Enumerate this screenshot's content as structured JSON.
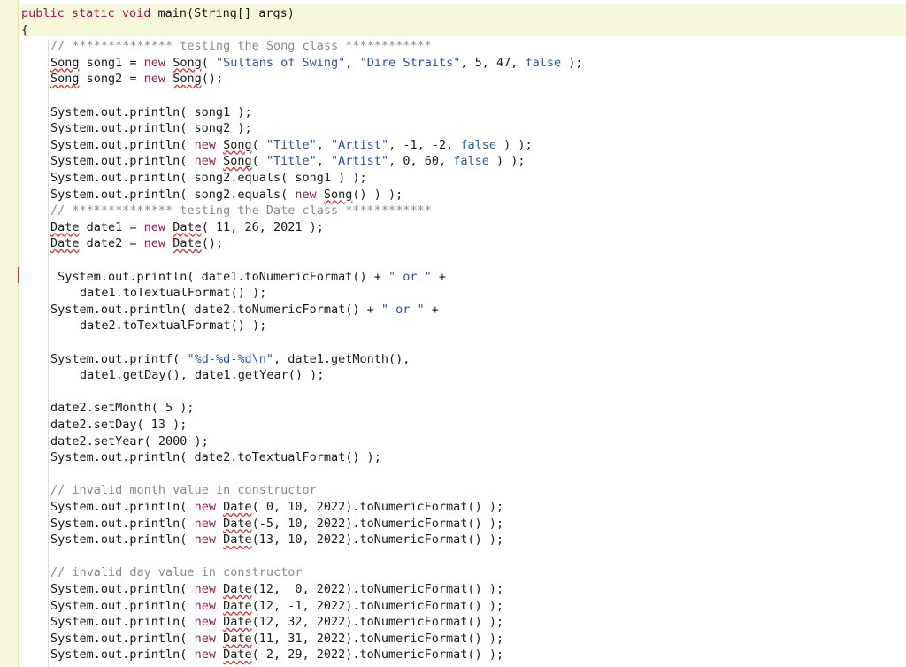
{
  "editor": {
    "language": "java",
    "lines": [
      {
        "indent": 0,
        "tokens": [
          {
            "t": "kw",
            "v": "public"
          },
          {
            "t": "p",
            "v": " "
          },
          {
            "t": "kw",
            "v": "static"
          },
          {
            "t": "p",
            "v": " "
          },
          {
            "t": "kw",
            "v": "void"
          },
          {
            "t": "p",
            "v": " main(String[] args)"
          }
        ]
      },
      {
        "indent": 0,
        "tokens": [
          {
            "t": "p",
            "v": "{"
          }
        ]
      },
      {
        "indent": 1,
        "tokens": [
          {
            "t": "cm",
            "v": "// ************** testing the Song class ************"
          }
        ]
      },
      {
        "indent": 1,
        "tokens": [
          {
            "t": "err",
            "v": "Song"
          },
          {
            "t": "p",
            "v": " song1 = "
          },
          {
            "t": "kw",
            "v": "new"
          },
          {
            "t": "p",
            "v": " "
          },
          {
            "t": "err",
            "v": "Song"
          },
          {
            "t": "p",
            "v": "( "
          },
          {
            "t": "str",
            "v": "\"Sultans of Swing\""
          },
          {
            "t": "p",
            "v": ", "
          },
          {
            "t": "str",
            "v": "\"Dire Straits\""
          },
          {
            "t": "p",
            "v": ", 5, 47, "
          },
          {
            "t": "bool",
            "v": "false"
          },
          {
            "t": "p",
            "v": " );"
          }
        ]
      },
      {
        "indent": 1,
        "tokens": [
          {
            "t": "err",
            "v": "Song"
          },
          {
            "t": "p",
            "v": " song2 = "
          },
          {
            "t": "kw",
            "v": "new"
          },
          {
            "t": "p",
            "v": " "
          },
          {
            "t": "err",
            "v": "Song"
          },
          {
            "t": "p",
            "v": "();"
          }
        ]
      },
      {
        "indent": 1,
        "tokens": []
      },
      {
        "indent": 1,
        "tokens": [
          {
            "t": "p",
            "v": "System.out.println( song1 );"
          }
        ]
      },
      {
        "indent": 1,
        "tokens": [
          {
            "t": "p",
            "v": "System.out.println( song2 );"
          }
        ]
      },
      {
        "indent": 1,
        "tokens": [
          {
            "t": "p",
            "v": "System.out.println( "
          },
          {
            "t": "kw",
            "v": "new"
          },
          {
            "t": "p",
            "v": " "
          },
          {
            "t": "err",
            "v": "Song"
          },
          {
            "t": "p",
            "v": "( "
          },
          {
            "t": "str",
            "v": "\"Title\""
          },
          {
            "t": "p",
            "v": ", "
          },
          {
            "t": "str",
            "v": "\"Artist\""
          },
          {
            "t": "p",
            "v": ", -1, -2, "
          },
          {
            "t": "bool",
            "v": "false"
          },
          {
            "t": "p",
            "v": " ) );"
          }
        ]
      },
      {
        "indent": 1,
        "tokens": [
          {
            "t": "p",
            "v": "System.out.println( "
          },
          {
            "t": "kw",
            "v": "new"
          },
          {
            "t": "p",
            "v": " "
          },
          {
            "t": "err",
            "v": "Song"
          },
          {
            "t": "p",
            "v": "( "
          },
          {
            "t": "str",
            "v": "\"Title\""
          },
          {
            "t": "p",
            "v": ", "
          },
          {
            "t": "str",
            "v": "\"Artist\""
          },
          {
            "t": "p",
            "v": ", 0, 60, "
          },
          {
            "t": "bool",
            "v": "false"
          },
          {
            "t": "p",
            "v": " ) );"
          }
        ]
      },
      {
        "indent": 1,
        "tokens": [
          {
            "t": "p",
            "v": "System.out.println( song2.equals( song1 ) );"
          }
        ]
      },
      {
        "indent": 1,
        "tokens": [
          {
            "t": "p",
            "v": "System.out.println( song2.equals( "
          },
          {
            "t": "kw",
            "v": "new"
          },
          {
            "t": "p",
            "v": " "
          },
          {
            "t": "err",
            "v": "Song"
          },
          {
            "t": "p",
            "v": "() ) );"
          }
        ]
      },
      {
        "indent": 1,
        "tokens": [
          {
            "t": "cm",
            "v": "// ************** testing the Date class ************"
          }
        ]
      },
      {
        "indent": 1,
        "tokens": [
          {
            "t": "err",
            "v": "Date"
          },
          {
            "t": "p",
            "v": " date1 = "
          },
          {
            "t": "kw",
            "v": "new"
          },
          {
            "t": "p",
            "v": " "
          },
          {
            "t": "err",
            "v": "Date"
          },
          {
            "t": "p",
            "v": "( 11, 26, 2021 );"
          }
        ]
      },
      {
        "indent": 1,
        "tokens": [
          {
            "t": "err",
            "v": "Date"
          },
          {
            "t": "p",
            "v": " date2 = "
          },
          {
            "t": "kw",
            "v": "new"
          },
          {
            "t": "p",
            "v": " "
          },
          {
            "t": "err",
            "v": "Date"
          },
          {
            "t": "p",
            "v": "();"
          }
        ]
      },
      {
        "indent": 1,
        "tokens": []
      },
      {
        "indent": 1,
        "tokens": [
          {
            "t": "p",
            "v": " System.out.println( date1.toNumericFormat() + "
          },
          {
            "t": "str",
            "v": "\" or \""
          },
          {
            "t": "p",
            "v": " +"
          }
        ]
      },
      {
        "indent": 2,
        "tokens": [
          {
            "t": "p",
            "v": "date1.toTextualFormat() );"
          }
        ]
      },
      {
        "indent": 1,
        "tokens": [
          {
            "t": "p",
            "v": "System.out.println( date2.toNumericFormat() + "
          },
          {
            "t": "str",
            "v": "\" or \""
          },
          {
            "t": "p",
            "v": " +"
          }
        ]
      },
      {
        "indent": 2,
        "tokens": [
          {
            "t": "p",
            "v": "date2.toTextualFormat() );"
          }
        ]
      },
      {
        "indent": 1,
        "tokens": []
      },
      {
        "indent": 1,
        "tokens": [
          {
            "t": "p",
            "v": "System.out.printf( "
          },
          {
            "t": "str",
            "v": "\"%d-%d-%d\\n\""
          },
          {
            "t": "p",
            "v": ", date1.getMonth(),"
          }
        ]
      },
      {
        "indent": 2,
        "tokens": [
          {
            "t": "p",
            "v": "date1.getDay(), date1.getYear() );"
          }
        ]
      },
      {
        "indent": 1,
        "tokens": []
      },
      {
        "indent": 1,
        "tokens": [
          {
            "t": "p",
            "v": "date2.setMonth( 5 );"
          }
        ]
      },
      {
        "indent": 1,
        "tokens": [
          {
            "t": "p",
            "v": "date2.setDay( 13 );"
          }
        ]
      },
      {
        "indent": 1,
        "tokens": [
          {
            "t": "p",
            "v": "date2.setYear( 2000 );"
          }
        ]
      },
      {
        "indent": 1,
        "tokens": [
          {
            "t": "p",
            "v": "System.out.println( date2.toTextualFormat() );"
          }
        ]
      },
      {
        "indent": 1,
        "tokens": []
      },
      {
        "indent": 1,
        "tokens": [
          {
            "t": "cm",
            "v": "// invalid month value in constructor"
          }
        ]
      },
      {
        "indent": 1,
        "tokens": [
          {
            "t": "p",
            "v": "System.out.println( "
          },
          {
            "t": "kw",
            "v": "new"
          },
          {
            "t": "p",
            "v": " "
          },
          {
            "t": "err",
            "v": "Date"
          },
          {
            "t": "p",
            "v": "( 0, 10, 2022).toNumericFormat() );"
          }
        ]
      },
      {
        "indent": 1,
        "tokens": [
          {
            "t": "p",
            "v": "System.out.println( "
          },
          {
            "t": "kw",
            "v": "new"
          },
          {
            "t": "p",
            "v": " "
          },
          {
            "t": "err",
            "v": "Date"
          },
          {
            "t": "p",
            "v": "(-5, 10, 2022).toNumericFormat() );"
          }
        ]
      },
      {
        "indent": 1,
        "tokens": [
          {
            "t": "p",
            "v": "System.out.println( "
          },
          {
            "t": "kw",
            "v": "new"
          },
          {
            "t": "p",
            "v": " "
          },
          {
            "t": "err",
            "v": "Date"
          },
          {
            "t": "p",
            "v": "(13, 10, 2022).toNumericFormat() );"
          }
        ]
      },
      {
        "indent": 1,
        "tokens": []
      },
      {
        "indent": 1,
        "tokens": [
          {
            "t": "cm",
            "v": "// invalid day value in constructor"
          }
        ]
      },
      {
        "indent": 1,
        "tokens": [
          {
            "t": "p",
            "v": "System.out.println( "
          },
          {
            "t": "kw",
            "v": "new"
          },
          {
            "t": "p",
            "v": " "
          },
          {
            "t": "err",
            "v": "Date"
          },
          {
            "t": "p",
            "v": "(12,  0, 2022).toNumericFormat() );"
          }
        ]
      },
      {
        "indent": 1,
        "tokens": [
          {
            "t": "p",
            "v": "System.out.println( "
          },
          {
            "t": "kw",
            "v": "new"
          },
          {
            "t": "p",
            "v": " "
          },
          {
            "t": "err",
            "v": "Date"
          },
          {
            "t": "p",
            "v": "(12, -1, 2022).toNumericFormat() );"
          }
        ]
      },
      {
        "indent": 1,
        "tokens": [
          {
            "t": "p",
            "v": "System.out.println( "
          },
          {
            "t": "kw",
            "v": "new"
          },
          {
            "t": "p",
            "v": " "
          },
          {
            "t": "err",
            "v": "Date"
          },
          {
            "t": "p",
            "v": "(12, 32, 2022).toNumericFormat() );"
          }
        ]
      },
      {
        "indent": 1,
        "tokens": [
          {
            "t": "p",
            "v": "System.out.println( "
          },
          {
            "t": "kw",
            "v": "new"
          },
          {
            "t": "p",
            "v": " "
          },
          {
            "t": "err",
            "v": "Date"
          },
          {
            "t": "p",
            "v": "(11, 31, 2022).toNumericFormat() );"
          }
        ]
      },
      {
        "indent": 1,
        "tokens": [
          {
            "t": "p",
            "v": "System.out.println( "
          },
          {
            "t": "kw",
            "v": "new"
          },
          {
            "t": "p",
            "v": " "
          },
          {
            "t": "err",
            "v": "Date"
          },
          {
            "t": "p",
            "v": "( 2, 29, 2022).toNumericFormat() );"
          }
        ]
      }
    ]
  }
}
